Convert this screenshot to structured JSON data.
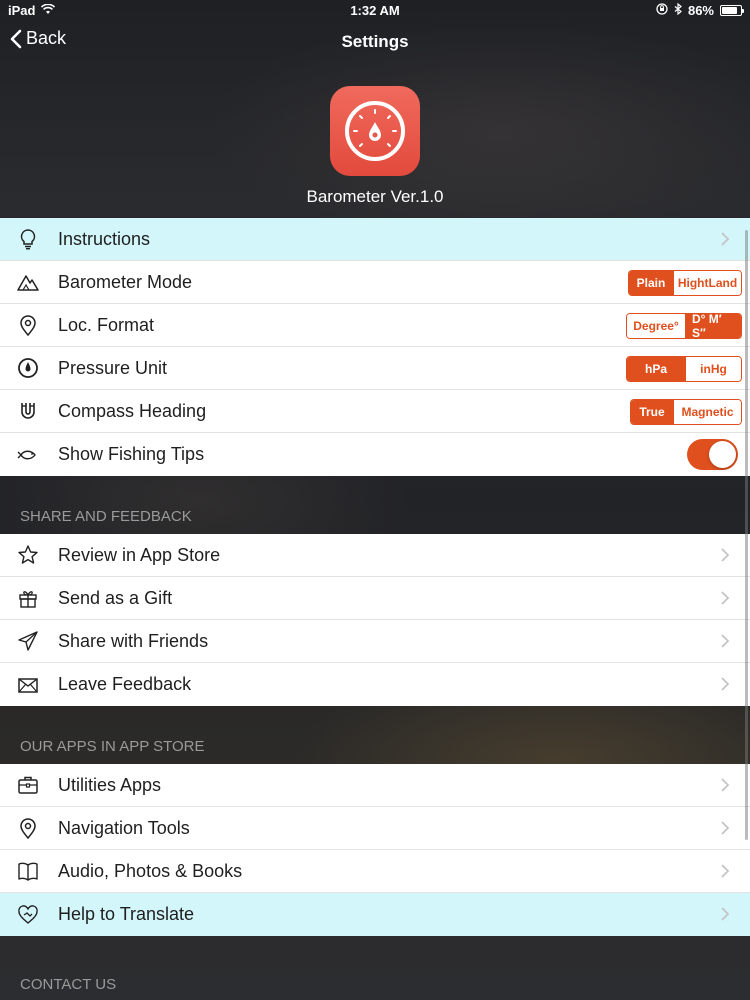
{
  "status_bar": {
    "device": "iPad",
    "time": "1:32 AM",
    "battery": "86%",
    "battery_level": 0.86
  },
  "nav": {
    "back_label": "Back",
    "title": "Settings"
  },
  "header": {
    "app_version": "Barometer Ver.1.0"
  },
  "settings": {
    "instructions": "Instructions",
    "barometer_mode": {
      "label": "Barometer Mode",
      "options": [
        "Plain",
        "HightLand"
      ],
      "selected": "Plain"
    },
    "loc_format": {
      "label": "Loc. Format",
      "options": [
        "Degree°",
        "D° M′ S″"
      ],
      "selected": "D° M′ S″"
    },
    "pressure_unit": {
      "label": "Pressure Unit",
      "options": [
        "hPa",
        "inHg"
      ],
      "selected": "hPa"
    },
    "compass_heading": {
      "label": "Compass Heading",
      "options": [
        "True",
        "Magnetic"
      ],
      "selected": "True"
    },
    "fishing_tips": {
      "label": "Show Fishing Tips",
      "on": true
    }
  },
  "share": {
    "header": "SHARE AND FEEDBACK",
    "items": [
      "Review in App Store",
      "Send as a Gift",
      "Share with Friends",
      "Leave Feedback"
    ]
  },
  "apps": {
    "header": "OUR APPS IN APP STORE",
    "items": [
      "Utilities Apps",
      "Navigation Tools",
      "Audio, Photos & Books",
      "Help to Translate"
    ]
  },
  "contact": {
    "header": "CONTACT US"
  },
  "colors": {
    "accent": "#e0501e",
    "highlight_row": "#d3f6fb"
  }
}
